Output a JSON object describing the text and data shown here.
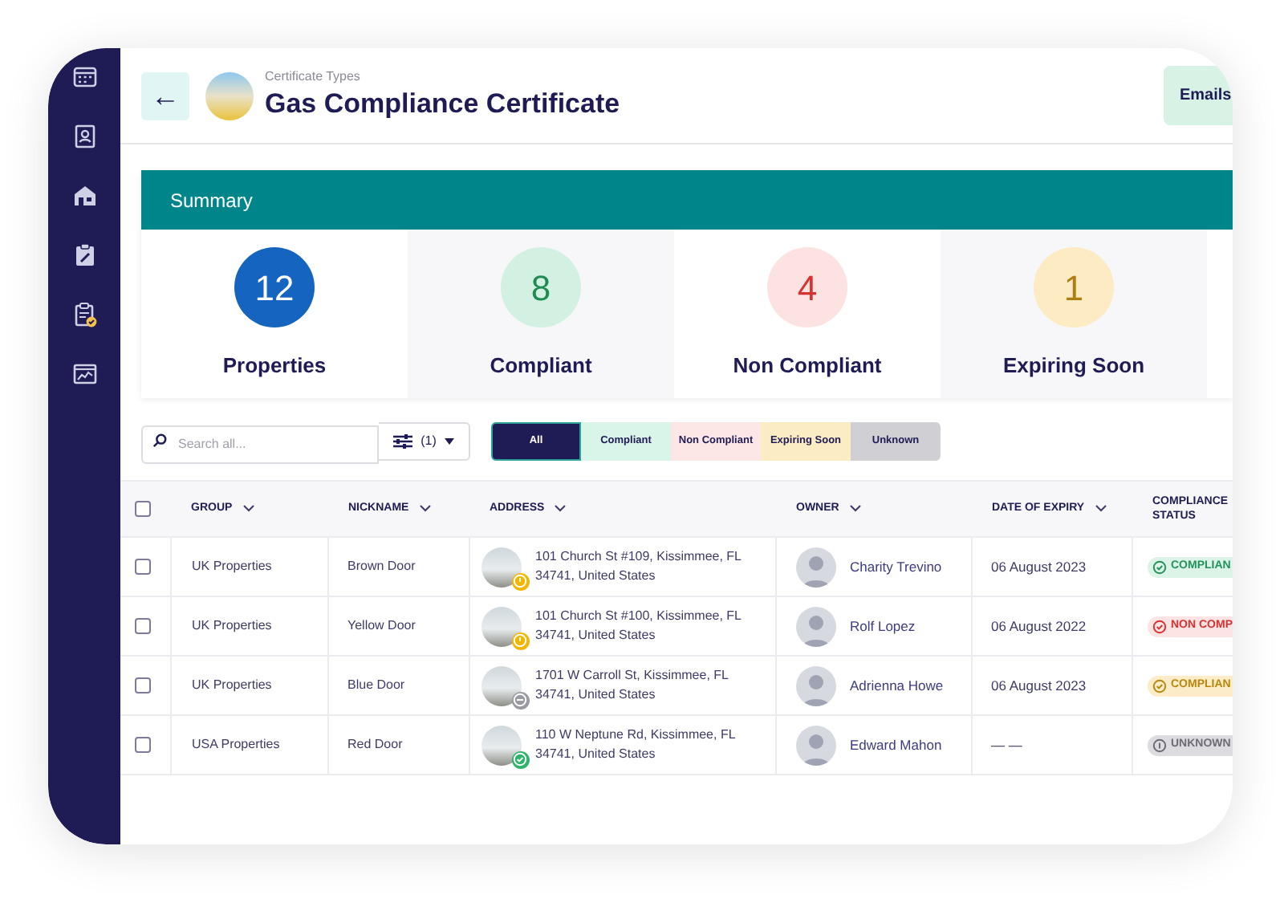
{
  "header": {
    "back": "←",
    "subtitle": "Certificate Types",
    "title": "Gas Compliance Certificate",
    "action": "Emails"
  },
  "summary": {
    "title": "Summary",
    "cards": [
      {
        "kind": "total",
        "count": "12",
        "label": "Properties"
      },
      {
        "kind": "compliant",
        "count": "8",
        "label": "Compliant"
      },
      {
        "kind": "non_compliant",
        "count": "4",
        "label": "Non Compliant"
      },
      {
        "kind": "expiring",
        "count": "1",
        "label": "Expiring Soon"
      }
    ]
  },
  "toolbar": {
    "search": {
      "placeholder": "Search all..."
    },
    "filter": {
      "count": "(1)"
    },
    "segments": [
      {
        "kind": "all",
        "label": "All",
        "selected": true
      },
      {
        "kind": "compliant",
        "label": "Compliant",
        "selected": false
      },
      {
        "kind": "non_compliant",
        "label": "Non Compliant",
        "selected": false
      },
      {
        "kind": "expiring",
        "label": "Expiring Soon",
        "selected": false
      },
      {
        "kind": "unknown",
        "label": "Unknown",
        "selected": false
      }
    ]
  },
  "table": {
    "select_all_checked": false,
    "columns": [
      {
        "label": "GROUP",
        "sortable": true
      },
      {
        "label": "NICKNAME",
        "sortable": true
      },
      {
        "label": "ADDRESS",
        "sortable": true
      },
      {
        "label": "OWNER",
        "sortable": true
      },
      {
        "label": "DATE OF EXPIRY",
        "sortable": true
      },
      {
        "label": "COMPLIANCE STATUS",
        "sortable": false
      }
    ],
    "rows": [
      {
        "checked": false,
        "group": "UK Properties",
        "nickname": "Brown Door",
        "address": {
          "text": "101 Church St #109, Kissimmee, FL 34741, United States",
          "kind": "warning"
        },
        "owner": "Charity Trevino",
        "expiry": "06 August 2023",
        "status": {
          "kind": "compliant",
          "label": "COMPLIAN"
        }
      },
      {
        "checked": false,
        "group": "UK Properties",
        "nickname": "Yellow Door",
        "address": {
          "text": "101 Church St #100, Kissimmee, FL 34741, United States",
          "kind": "warning"
        },
        "owner": "Rolf Lopez",
        "expiry": "06 August 2022",
        "status": {
          "kind": "non_compliant",
          "label": "NON COMP"
        }
      },
      {
        "checked": false,
        "group": "UK Properties",
        "nickname": "Blue Door",
        "address": {
          "text": "1701 W Carroll St, Kissimmee, FL 34741, United States",
          "kind": "blocked"
        },
        "owner": "Adrienna Howe",
        "expiry": "06 August 2023",
        "status": {
          "kind": "expiring",
          "label": "COMPLIAN"
        }
      },
      {
        "checked": false,
        "group": "USA Properties",
        "nickname": "Red Door",
        "address": {
          "text": "110 W Neptune Rd, Kissimmee, FL 34741, United States",
          "kind": "check"
        },
        "owner": "Edward Mahon",
        "expiry": "— —",
        "status": {
          "kind": "unknown",
          "label": "UNKNOWN"
        }
      }
    ]
  }
}
